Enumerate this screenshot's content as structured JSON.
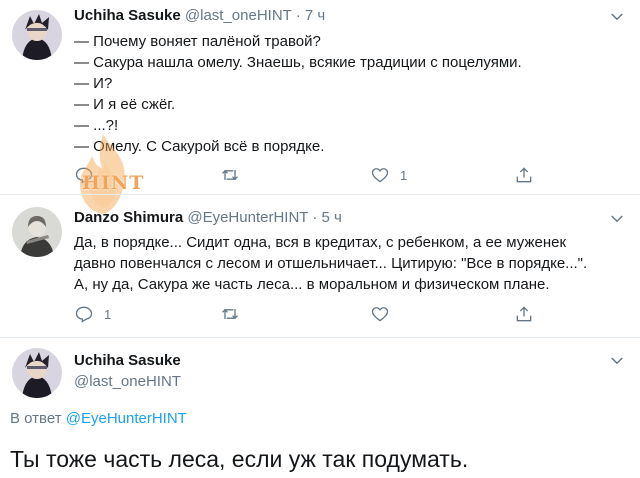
{
  "tweets": [
    {
      "name": "Uchiha Sasuke",
      "handle": "@last_oneHINT",
      "dot": "·",
      "time": "7 ч",
      "lines": [
        "— Почему воняет палёной травой?",
        "— Сакура нашла омелу. Знаешь, всякие традиции с поцелуями.",
        "— И?",
        "— И я её сжёг.",
        "— ...?!",
        "— Омелу. С Сакурой всё в порядке."
      ],
      "reply_count": "",
      "retweet_count": "",
      "like_count": "1"
    },
    {
      "name": "Danzo Shimura",
      "handle": "@EyeHunterHINT",
      "dot": "·",
      "time": "5 ч",
      "lines": [
        "Да, в порядке... Сидит одна, вся в кредитах, с ребенком, а ее муженек",
        "давно повенчался с лесом и отшельничает... Цитирую: \"Все в порядке...\".",
        "А, ну да, Сакура же часть леса... в моральном и физическом плане."
      ],
      "reply_count": "1",
      "retweet_count": "",
      "like_count": ""
    }
  ],
  "main_tweet": {
    "name": "Uchiha Sasuke",
    "handle": "@last_oneHINT",
    "reply_prefix": "В ответ ",
    "reply_handle": "@EyeHunterHINT",
    "text": "Ты тоже часть леса, если уж так подумать."
  },
  "watermark_text": "HINT",
  "colors": {
    "text": "#14171a",
    "secondary": "#657786",
    "link": "#1da1f2",
    "divider": "#e6ecf0"
  },
  "icons": [
    "chevron-down-icon",
    "reply-icon",
    "retweet-icon",
    "like-icon",
    "share-icon"
  ]
}
